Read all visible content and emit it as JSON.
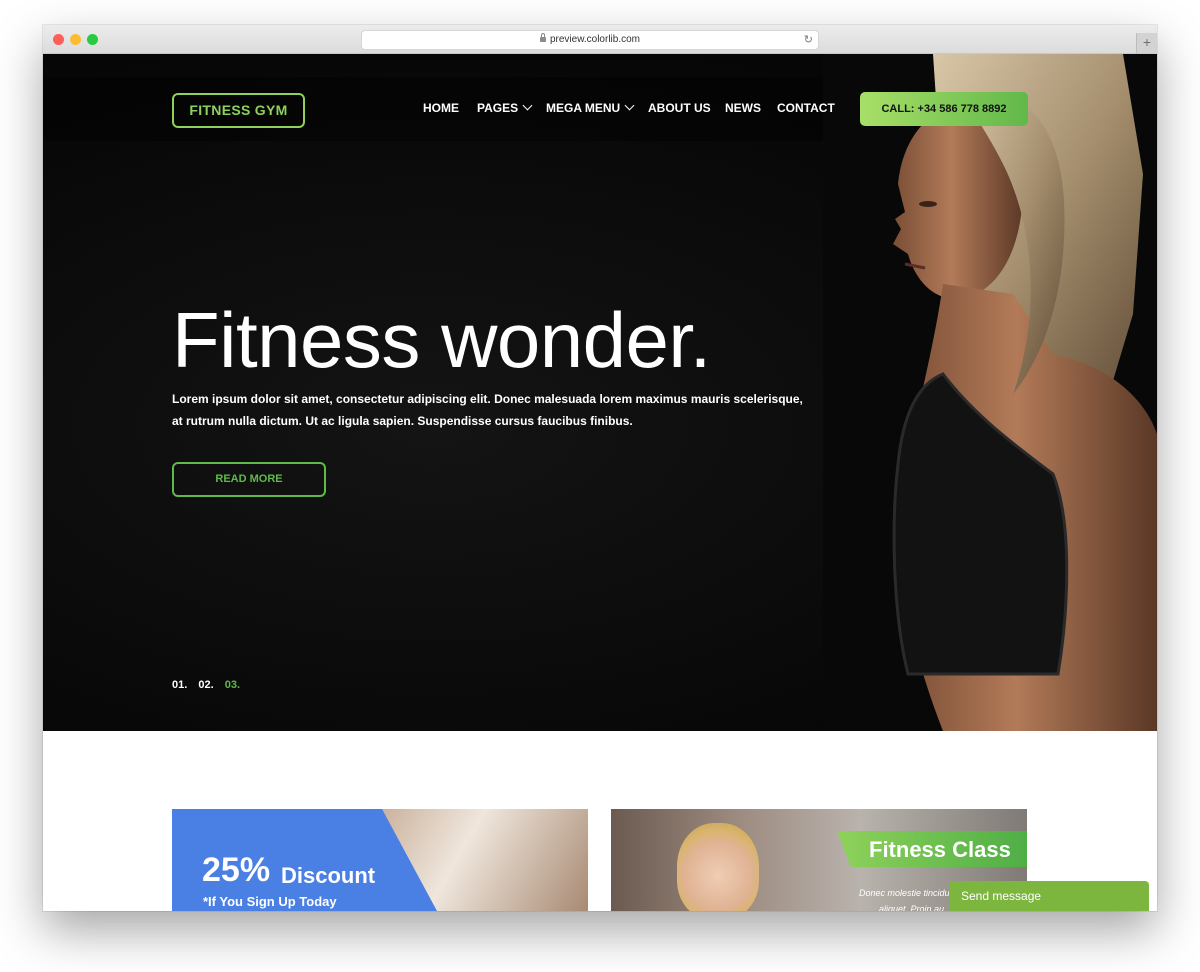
{
  "browser": {
    "url": "preview.colorlib.com",
    "new_tab_symbol": "+"
  },
  "header": {
    "logo": "FITNESS GYM",
    "nav": [
      {
        "label": "HOME"
      },
      {
        "label": "PAGES"
      },
      {
        "label": "MEGA MENU"
      },
      {
        "label": "ABOUT US"
      },
      {
        "label": "NEWS"
      },
      {
        "label": "CONTACT"
      }
    ],
    "call_button": "CALL: +34 586 778 8892"
  },
  "hero": {
    "headline": "Fitness wonder.",
    "lead": "Lorem ipsum dolor sit amet, consectetur adipiscing elit. Donec malesuada lorem maximus mauris scelerisque, at rutrum nulla dictum. Ut ac ligula sapien. Suspendisse cursus faucibus finibus.",
    "read_more": "READ MORE",
    "slides": [
      "01.",
      "02.",
      "03."
    ],
    "active_slide_index": 2
  },
  "cards": {
    "discount": {
      "percent": "25%",
      "word": "Discount",
      "sub": "*If You Sign Up Today"
    },
    "class": {
      "title": "Fitness Class",
      "text_line1": "Donec molestie tincidu",
      "text_line2": "aliquet. Proin au"
    }
  },
  "chat": {
    "label": "Send message"
  },
  "colors": {
    "accent_green": "#5fba48",
    "logo_green": "#8ed15b",
    "discount_blue": "#4a7fe3",
    "chat_green": "#7cb63f"
  }
}
